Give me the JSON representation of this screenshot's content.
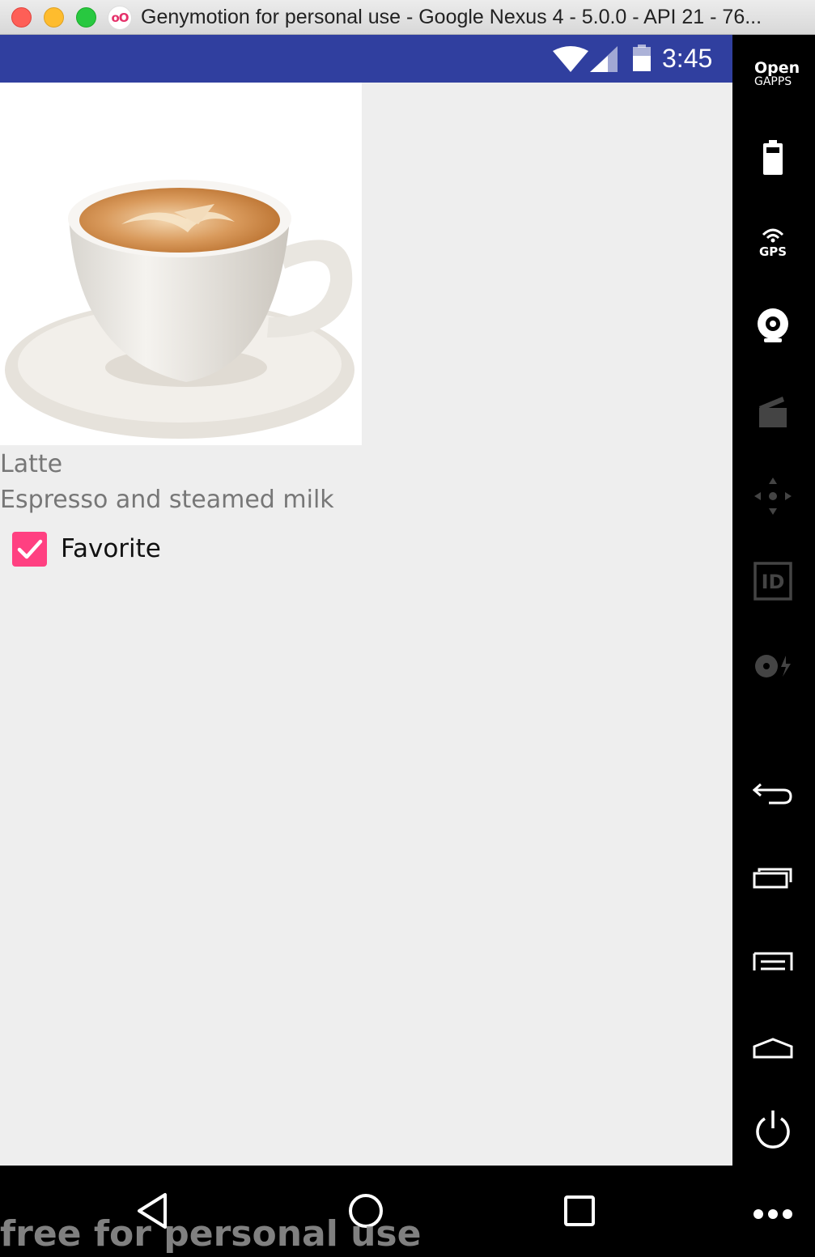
{
  "window": {
    "title": "Genymotion for personal use - Google Nexus 4 - 5.0.0 - API 21 - 76...",
    "logo_text": "oO"
  },
  "status_bar": {
    "time": "3:45",
    "color": "#303f9f"
  },
  "content": {
    "image_icon": "latte-coffee-cup-image",
    "drink_name": "Latte",
    "drink_description": "Espresso and steamed milk",
    "favorite_label": "Favorite",
    "favorite_checked": true,
    "accent_color": "#ff4081"
  },
  "toolbar": {
    "opengapps_line1": "Open",
    "opengapps_line2": "GAPPS",
    "gps_label": "GPS",
    "id_label": "ID",
    "items": [
      "battery-icon",
      "gps-icon",
      "webcam-icon",
      "screencast-icon",
      "dpad-icon",
      "identifiers-icon",
      "disk-io-icon",
      "back-icon",
      "recent-apps-icon",
      "menu-icon",
      "home-icon",
      "power-icon"
    ]
  },
  "nav": {
    "items": [
      "back-nav-icon",
      "home-nav-icon",
      "recents-nav-icon"
    ],
    "watermark": "free for personal use"
  }
}
